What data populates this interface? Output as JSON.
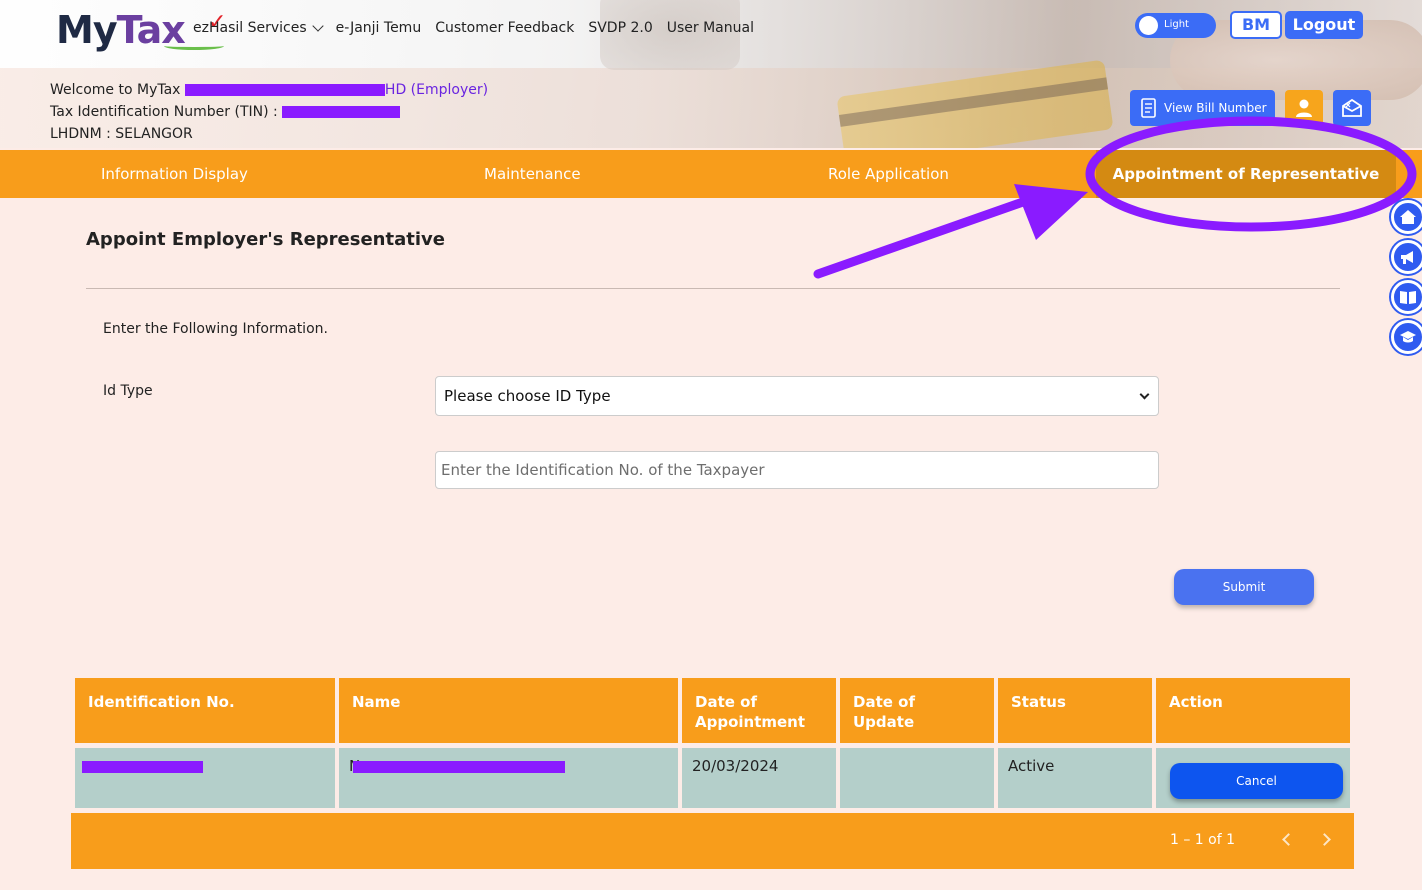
{
  "brand": {
    "my": "My",
    "tax": "Tax"
  },
  "nav": {
    "items": [
      "ezHasil Services",
      "e-Janji Temu",
      "Customer Feedback",
      "SVDP 2.0",
      "User Manual"
    ]
  },
  "top_controls": {
    "theme_label": "Light",
    "language_label": "BM",
    "logout_label": "Logout"
  },
  "account": {
    "welcome_prefix": "Welcome to MyTax",
    "welcome_suffix": "HD (Employer)",
    "tin_label": "Tax Identification Number (TIN) :",
    "office": "LHDNM : SELANGOR"
  },
  "actions": {
    "view_bill": "View Bill Number"
  },
  "tabs": [
    "Information Display",
    "Maintenance",
    "Role Application",
    "Appointment of Representative"
  ],
  "form": {
    "title": "Appoint Employer's Representative",
    "instruction": "Enter the Following Information.",
    "id_type_label": "Id Type",
    "id_type_value": "Please choose ID Type",
    "id_no_placeholder": "Enter the Identification No. of the Taxpayer",
    "submit_label": "Submit"
  },
  "table": {
    "columns": [
      "Identification No.",
      "Name",
      "Date of Appointment",
      "Date of Update",
      "Status",
      "Action"
    ],
    "rows": [
      {
        "name_initial": "N",
        "date_of_appointment": "20/03/2024",
        "date_of_update": "",
        "status": "Active",
        "action": "Cancel"
      }
    ],
    "pagination": "1 – 1 of 1"
  },
  "colors": {
    "orange": "#f89d1b",
    "blue": "#3b6cf6",
    "annotation": "#8a1bff",
    "row_bg": "#b4cfca"
  }
}
